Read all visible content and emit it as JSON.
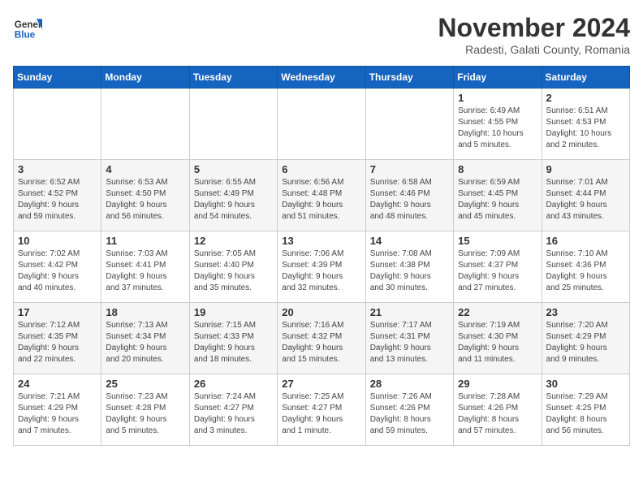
{
  "logo": {
    "general": "General",
    "blue": "Blue"
  },
  "title": "November 2024",
  "location": "Radesti, Galati County, Romania",
  "days_of_week": [
    "Sunday",
    "Monday",
    "Tuesday",
    "Wednesday",
    "Thursday",
    "Friday",
    "Saturday"
  ],
  "weeks": [
    [
      {
        "day": "",
        "info": ""
      },
      {
        "day": "",
        "info": ""
      },
      {
        "day": "",
        "info": ""
      },
      {
        "day": "",
        "info": ""
      },
      {
        "day": "",
        "info": ""
      },
      {
        "day": "1",
        "info": "Sunrise: 6:49 AM\nSunset: 4:55 PM\nDaylight: 10 hours\nand 5 minutes."
      },
      {
        "day": "2",
        "info": "Sunrise: 6:51 AM\nSunset: 4:53 PM\nDaylight: 10 hours\nand 2 minutes."
      }
    ],
    [
      {
        "day": "3",
        "info": "Sunrise: 6:52 AM\nSunset: 4:52 PM\nDaylight: 9 hours\nand 59 minutes."
      },
      {
        "day": "4",
        "info": "Sunrise: 6:53 AM\nSunset: 4:50 PM\nDaylight: 9 hours\nand 56 minutes."
      },
      {
        "day": "5",
        "info": "Sunrise: 6:55 AM\nSunset: 4:49 PM\nDaylight: 9 hours\nand 54 minutes."
      },
      {
        "day": "6",
        "info": "Sunrise: 6:56 AM\nSunset: 4:48 PM\nDaylight: 9 hours\nand 51 minutes."
      },
      {
        "day": "7",
        "info": "Sunrise: 6:58 AM\nSunset: 4:46 PM\nDaylight: 9 hours\nand 48 minutes."
      },
      {
        "day": "8",
        "info": "Sunrise: 6:59 AM\nSunset: 4:45 PM\nDaylight: 9 hours\nand 45 minutes."
      },
      {
        "day": "9",
        "info": "Sunrise: 7:01 AM\nSunset: 4:44 PM\nDaylight: 9 hours\nand 43 minutes."
      }
    ],
    [
      {
        "day": "10",
        "info": "Sunrise: 7:02 AM\nSunset: 4:42 PM\nDaylight: 9 hours\nand 40 minutes."
      },
      {
        "day": "11",
        "info": "Sunrise: 7:03 AM\nSunset: 4:41 PM\nDaylight: 9 hours\nand 37 minutes."
      },
      {
        "day": "12",
        "info": "Sunrise: 7:05 AM\nSunset: 4:40 PM\nDaylight: 9 hours\nand 35 minutes."
      },
      {
        "day": "13",
        "info": "Sunrise: 7:06 AM\nSunset: 4:39 PM\nDaylight: 9 hours\nand 32 minutes."
      },
      {
        "day": "14",
        "info": "Sunrise: 7:08 AM\nSunset: 4:38 PM\nDaylight: 9 hours\nand 30 minutes."
      },
      {
        "day": "15",
        "info": "Sunrise: 7:09 AM\nSunset: 4:37 PM\nDaylight: 9 hours\nand 27 minutes."
      },
      {
        "day": "16",
        "info": "Sunrise: 7:10 AM\nSunset: 4:36 PM\nDaylight: 9 hours\nand 25 minutes."
      }
    ],
    [
      {
        "day": "17",
        "info": "Sunrise: 7:12 AM\nSunset: 4:35 PM\nDaylight: 9 hours\nand 22 minutes."
      },
      {
        "day": "18",
        "info": "Sunrise: 7:13 AM\nSunset: 4:34 PM\nDaylight: 9 hours\nand 20 minutes."
      },
      {
        "day": "19",
        "info": "Sunrise: 7:15 AM\nSunset: 4:33 PM\nDaylight: 9 hours\nand 18 minutes."
      },
      {
        "day": "20",
        "info": "Sunrise: 7:16 AM\nSunset: 4:32 PM\nDaylight: 9 hours\nand 15 minutes."
      },
      {
        "day": "21",
        "info": "Sunrise: 7:17 AM\nSunset: 4:31 PM\nDaylight: 9 hours\nand 13 minutes."
      },
      {
        "day": "22",
        "info": "Sunrise: 7:19 AM\nSunset: 4:30 PM\nDaylight: 9 hours\nand 11 minutes."
      },
      {
        "day": "23",
        "info": "Sunrise: 7:20 AM\nSunset: 4:29 PM\nDaylight: 9 hours\nand 9 minutes."
      }
    ],
    [
      {
        "day": "24",
        "info": "Sunrise: 7:21 AM\nSunset: 4:29 PM\nDaylight: 9 hours\nand 7 minutes."
      },
      {
        "day": "25",
        "info": "Sunrise: 7:23 AM\nSunset: 4:28 PM\nDaylight: 9 hours\nand 5 minutes."
      },
      {
        "day": "26",
        "info": "Sunrise: 7:24 AM\nSunset: 4:27 PM\nDaylight: 9 hours\nand 3 minutes."
      },
      {
        "day": "27",
        "info": "Sunrise: 7:25 AM\nSunset: 4:27 PM\nDaylight: 9 hours\nand 1 minute."
      },
      {
        "day": "28",
        "info": "Sunrise: 7:26 AM\nSunset: 4:26 PM\nDaylight: 8 hours\nand 59 minutes."
      },
      {
        "day": "29",
        "info": "Sunrise: 7:28 AM\nSunset: 4:26 PM\nDaylight: 8 hours\nand 57 minutes."
      },
      {
        "day": "30",
        "info": "Sunrise: 7:29 AM\nSunset: 4:25 PM\nDaylight: 8 hours\nand 56 minutes."
      }
    ]
  ]
}
